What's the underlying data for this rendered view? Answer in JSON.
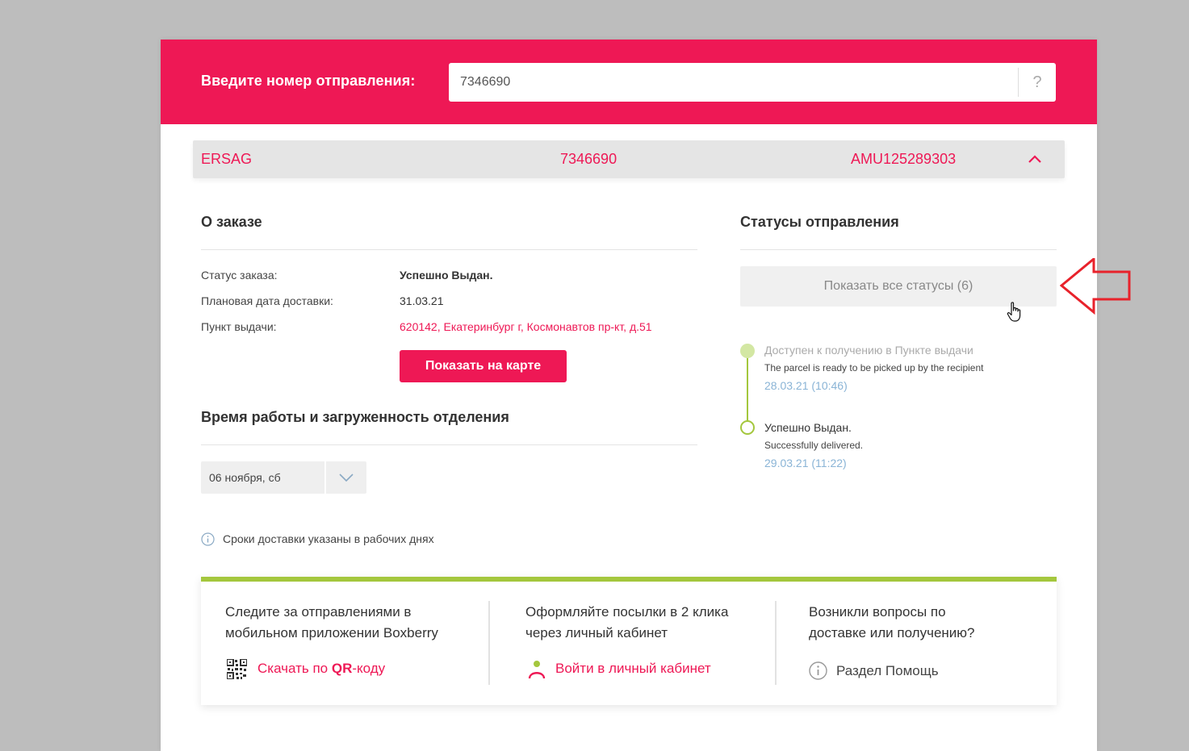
{
  "header": {
    "prompt_label": "Введите номер отправления:",
    "tracking_value": "7346690",
    "help_icon": "?"
  },
  "shipment_bar": {
    "sender": "ERSAG",
    "number": "7346690",
    "code": "AMU125289303",
    "toggle_icon": "chevron-up-icon"
  },
  "order": {
    "title": "О заказе",
    "status_label": "Статус заказа:",
    "status_value": "Успешно Выдан.",
    "date_label": "Плановая дата доставки:",
    "date_value": "31.03.21",
    "point_label": "Пункт выдачи:",
    "point_value": "620142, Екатеринбург г, Космонавтов пр-кт, д.51",
    "map_button": "Показать на карте"
  },
  "hours": {
    "title": "Время работы и загруженность отделения",
    "date_select": "06 ноября, сб",
    "note": "Сроки доставки указаны в рабочих днях"
  },
  "statuses": {
    "title": "Статусы отправления",
    "show_all_button": "Показать все статусы (6)",
    "items": [
      {
        "title": "Доступен к получению в Пункте выдачи",
        "subtitle": "The parcel is ready to be picked up by the recipient",
        "date": "28.03.21 (10:46)"
      },
      {
        "title": "Успешно Выдан.",
        "subtitle": "Successfully delivered.",
        "date": "29.03.21 (11:22)"
      }
    ]
  },
  "promo": {
    "app_title_line1": "Следите за отправлениями в",
    "app_title_line2": "мобильном приложении Boxberry",
    "app_link_prefix": "Скачать по ",
    "app_link_bold": "QR",
    "app_link_suffix": "-коду",
    "cabinet_title_line1": "Оформляйте посылки в 2 клика",
    "cabinet_title_line2": "через личный кабинет",
    "cabinet_link": "Войти в личный кабинет",
    "help_title_line1": "Возникли вопросы по",
    "help_title_line2": "доставке или получению?",
    "help_link": "Раздел Помощь"
  },
  "colors": {
    "brand": "#ee1855",
    "accent_green": "#a4c73d",
    "date_blue": "#8ab4d6",
    "annotation_red": "#e8222b"
  }
}
